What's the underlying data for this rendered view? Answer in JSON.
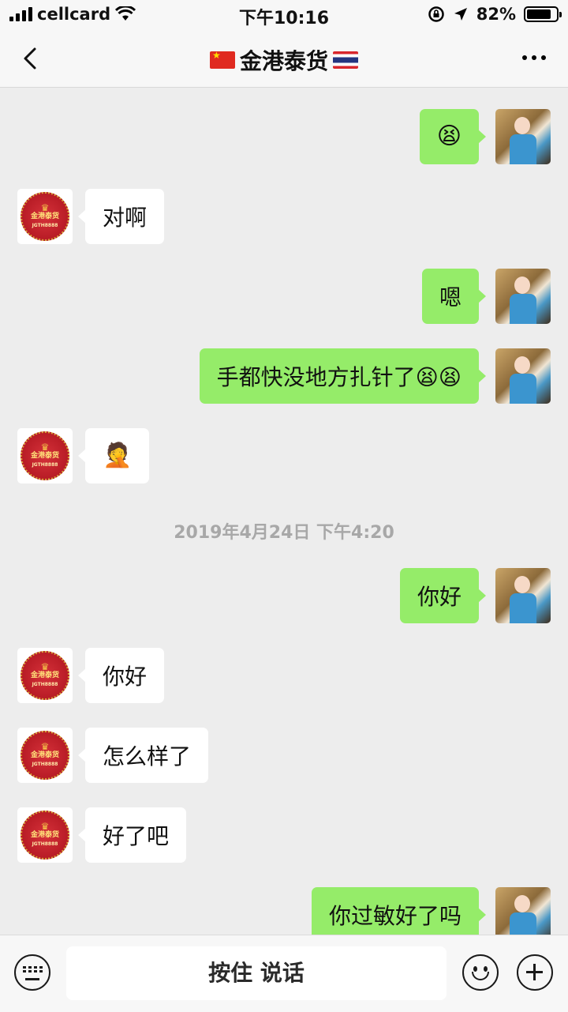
{
  "status_bar": {
    "carrier": "cellcard",
    "time": "下午10:16",
    "battery": "82%",
    "battery_level": 0.82
  },
  "header": {
    "title": "金港泰货",
    "left_flag": "china-flag-icon",
    "right_flag": "thailand-flag-icon"
  },
  "contact_avatar": {
    "title": "金港泰货",
    "id": "JGTH8888"
  },
  "messages": [
    {
      "sender": "me",
      "text": "😫"
    },
    {
      "sender": "other",
      "text": "对啊"
    },
    {
      "sender": "me",
      "text": "嗯"
    },
    {
      "sender": "me",
      "text": "手都快没地方扎针了😫😫"
    },
    {
      "sender": "other",
      "text": "🤦"
    },
    {
      "type": "timestamp",
      "text": "2019年4月24日 下午4:20"
    },
    {
      "sender": "me",
      "text": "你好"
    },
    {
      "sender": "other",
      "text": "你好"
    },
    {
      "sender": "other",
      "text": "怎么样了"
    },
    {
      "sender": "other",
      "text": "好了吧"
    },
    {
      "sender": "me",
      "text": "你过敏好了吗"
    }
  ],
  "input_bar": {
    "hold_to_talk": "按住 说话"
  },
  "colors": {
    "my_bubble": "#95ec69",
    "their_bubble": "#ffffff",
    "background": "#ededed"
  }
}
